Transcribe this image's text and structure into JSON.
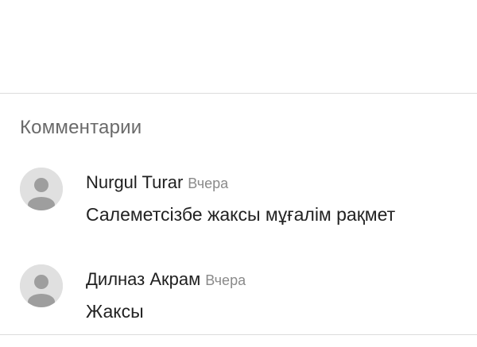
{
  "comments_section": {
    "title": "Комментарии",
    "comments": [
      {
        "author": "Nurgul Turar",
        "time": "Вчера",
        "text": "Салеметсізбе жаксы мұғалім рақмет",
        "avatar_icon": "default-user-avatar-icon"
      },
      {
        "author": "Дилназ Акрам",
        "time": "Вчера",
        "text": "Жаксы",
        "avatar_icon": "default-user-avatar-icon"
      }
    ]
  }
}
